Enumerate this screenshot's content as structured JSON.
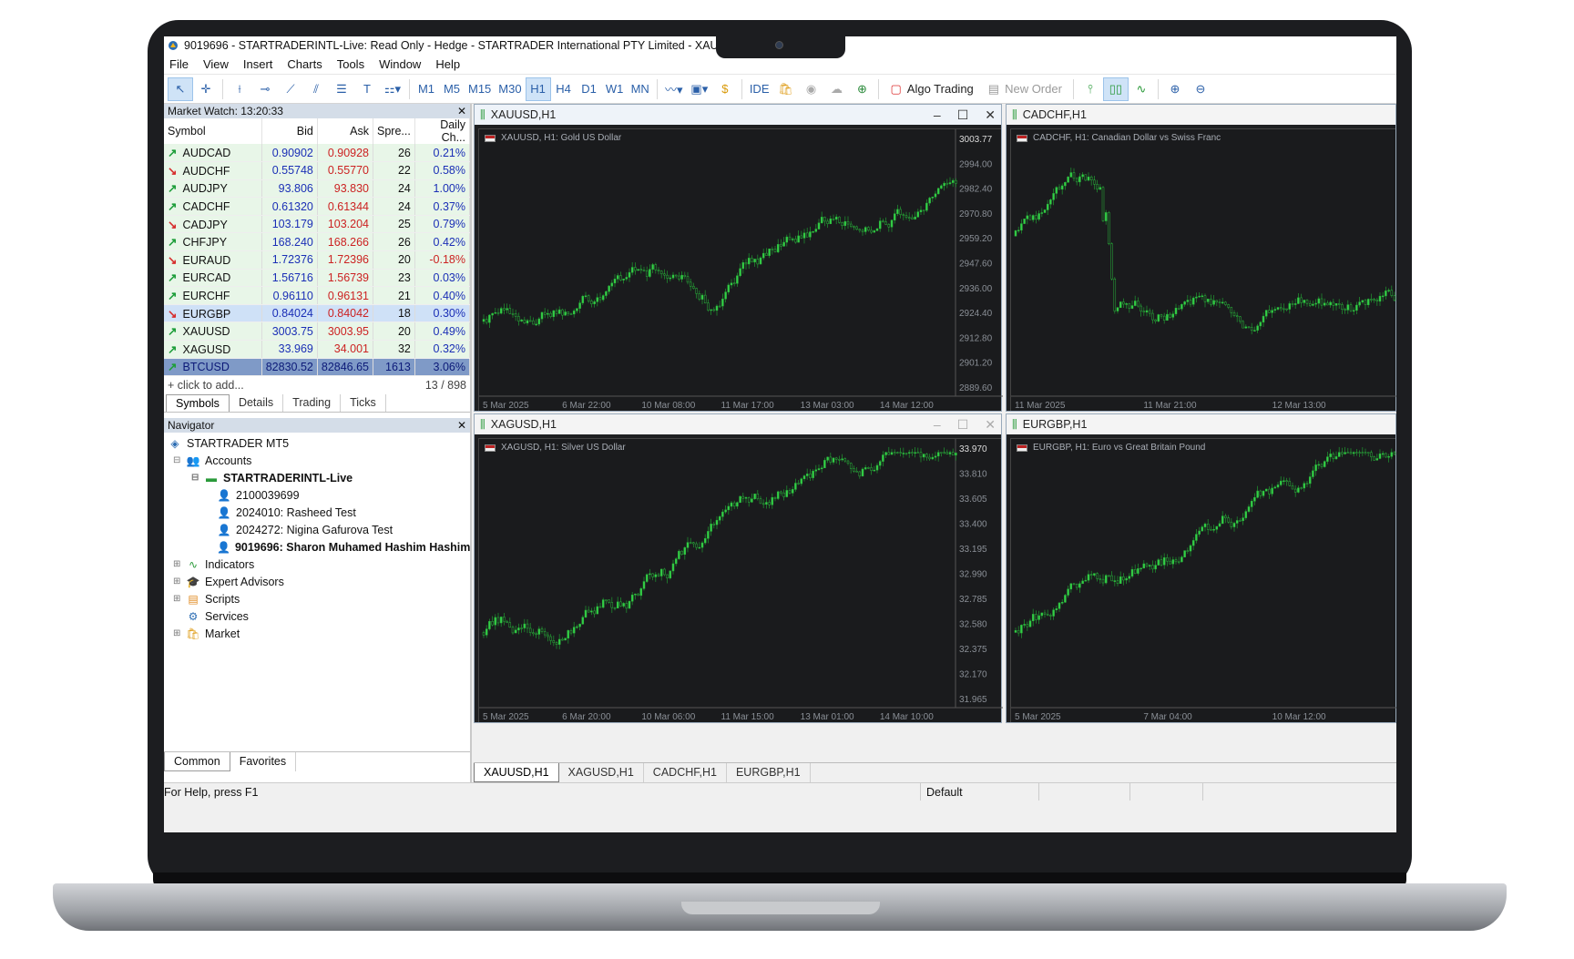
{
  "window": {
    "title": "9019696 - STARTRADERINTL-Live: Read Only - Hedge - STARTRADER International PTY Limited - XAU"
  },
  "menu": [
    "File",
    "View",
    "Insert",
    "Charts",
    "Tools",
    "Window",
    "Help"
  ],
  "toolbar": {
    "timeframes": [
      "M1",
      "M5",
      "M15",
      "M30",
      "H1",
      "H4",
      "D1",
      "W1",
      "MN"
    ],
    "active_timeframe": "H1",
    "ide_label": "IDE",
    "algo_label": "Algo Trading",
    "new_order_label": "New Order"
  },
  "market_watch": {
    "header": "Market Watch: 13:20:33",
    "columns": [
      "Symbol",
      "Bid",
      "Ask",
      "Spre...",
      "Daily Ch..."
    ],
    "rows": [
      {
        "symbol": "AUDCAD",
        "dir": "up",
        "bid": "0.90902",
        "ask": "0.90928",
        "spread": "26",
        "change": "0.21%"
      },
      {
        "symbol": "AUDCHF",
        "dir": "down",
        "bid": "0.55748",
        "ask": "0.55770",
        "spread": "22",
        "change": "0.58%"
      },
      {
        "symbol": "AUDJPY",
        "dir": "up",
        "bid": "93.806",
        "ask": "93.830",
        "spread": "24",
        "change": "1.00%"
      },
      {
        "symbol": "CADCHF",
        "dir": "up",
        "bid": "0.61320",
        "ask": "0.61344",
        "spread": "24",
        "change": "0.37%"
      },
      {
        "symbol": "CADJPY",
        "dir": "down",
        "bid": "103.179",
        "ask": "103.204",
        "spread": "25",
        "change": "0.79%"
      },
      {
        "symbol": "CHFJPY",
        "dir": "up",
        "bid": "168.240",
        "ask": "168.266",
        "spread": "26",
        "change": "0.42%"
      },
      {
        "symbol": "EURAUD",
        "dir": "down",
        "bid": "1.72376",
        "ask": "1.72396",
        "spread": "20",
        "change": "-0.18%"
      },
      {
        "symbol": "EURCAD",
        "dir": "up",
        "bid": "1.56716",
        "ask": "1.56739",
        "spread": "23",
        "change": "0.03%"
      },
      {
        "symbol": "EURCHF",
        "dir": "up",
        "bid": "0.96110",
        "ask": "0.96131",
        "spread": "21",
        "change": "0.40%"
      },
      {
        "symbol": "EURGBP",
        "dir": "down",
        "bid": "0.84024",
        "ask": "0.84042",
        "spread": "18",
        "change": "0.30%"
      },
      {
        "symbol": "XAUUSD",
        "dir": "up",
        "bid": "3003.75",
        "ask": "3003.95",
        "spread": "20",
        "change": "0.49%"
      },
      {
        "symbol": "XAGUSD",
        "dir": "up",
        "bid": "33.969",
        "ask": "34.001",
        "spread": "32",
        "change": "0.32%"
      },
      {
        "symbol": "BTCUSD",
        "dir": "up",
        "bid": "82830.52",
        "ask": "82846.65",
        "spread": "1613",
        "change": "3.06%"
      }
    ],
    "add_label": "click to add...",
    "count": "13 / 898",
    "tabs": [
      "Symbols",
      "Details",
      "Trading",
      "Ticks"
    ]
  },
  "navigator": {
    "header": "Navigator",
    "root": "STARTRADER MT5",
    "accounts_label": "Accounts",
    "server": "STARTRADERINTL-Live",
    "accounts": [
      "2100039699",
      "2024010: Rasheed Test",
      "2024272: Nigina Gafurova Test",
      "9019696: Sharon Muhamed Hashim  Hashim"
    ],
    "sections": [
      "Indicators",
      "Expert Advisors",
      "Scripts",
      "Services",
      "Market"
    ],
    "tabs": [
      "Common",
      "Favorites"
    ]
  },
  "charts": [
    {
      "title": "XAUUSD,H1",
      "info": "XAUUSD, H1:  Gold US Dollar",
      "prices": [
        "3003.77",
        "2994.00",
        "2982.40",
        "2970.80",
        "2959.20",
        "2947.60",
        "2936.00",
        "2924.40",
        "2912.80",
        "2901.20",
        "2889.60"
      ],
      "dates": [
        "5 Mar 2025",
        "6 Mar 22:00",
        "10 Mar 08:00",
        "11 Mar 17:00",
        "13 Mar 03:00",
        "14 Mar 12:00"
      ]
    },
    {
      "title": "CADCHF,H1",
      "info": "CADCHF, H1:  Canadian Dollar vs Swiss Franc",
      "dates": [
        "11 Mar 2025",
        "11 Mar 21:00",
        "12 Mar 13:00"
      ]
    },
    {
      "title": "XAGUSD,H1",
      "info": "XAGUSD, H1:  Silver US Dollar",
      "prices": [
        "33.970",
        "33.810",
        "33.605",
        "33.400",
        "33.195",
        "32.990",
        "32.785",
        "32.580",
        "32.375",
        "32.170",
        "31.965"
      ],
      "dates": [
        "5 Mar 2025",
        "6 Mar 20:00",
        "10 Mar 06:00",
        "11 Mar 15:00",
        "13 Mar 01:00",
        "14 Mar 10:00"
      ]
    },
    {
      "title": "EURGBP,H1",
      "info": "EURGBP, H1:  Euro vs Great Britain Pound",
      "dates": [
        "5 Mar 2025",
        "7 Mar 04:00",
        "10 Mar 12:00"
      ]
    }
  ],
  "chart_tabs": [
    "XAUUSD,H1",
    "XAGUSD,H1",
    "CADCHF,H1",
    "EURGBP,H1"
  ],
  "status": {
    "help": "For Help, press F1",
    "profile": "Default"
  },
  "colors": {
    "bull_candle": "#2ecc40",
    "bg": "#1a1b1d"
  }
}
